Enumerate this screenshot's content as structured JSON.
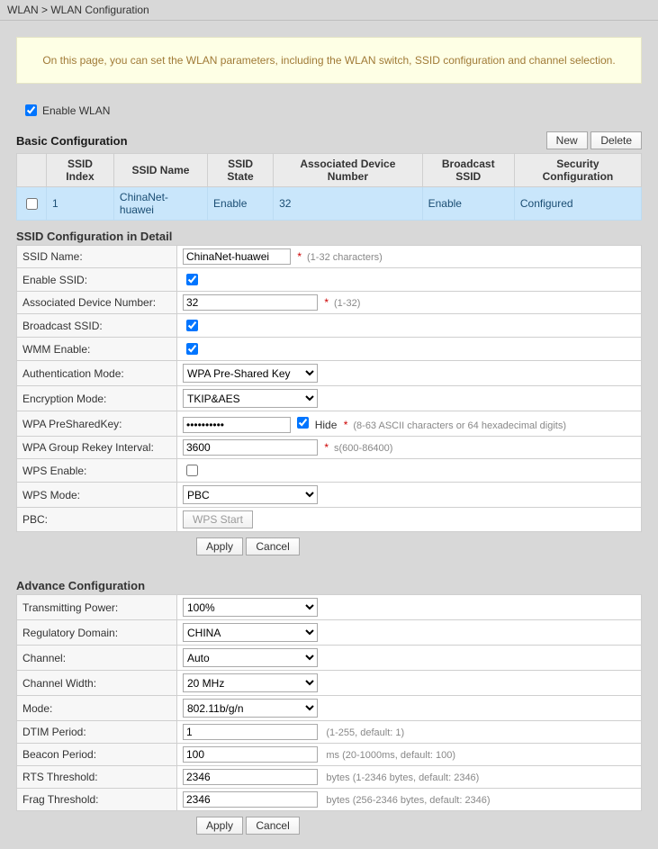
{
  "breadcrumb": "WLAN > WLAN Configuration",
  "hint": "On this page, you can set the WLAN parameters, including the WLAN switch, SSID configuration and channel selection.",
  "enableWlan": {
    "label": "Enable WLAN",
    "checked": true
  },
  "basic": {
    "title": "Basic Configuration",
    "btn_new": "New",
    "btn_delete": "Delete",
    "headers": {
      "idx": "SSID Index",
      "name": "SSID Name",
      "state": "SSID State",
      "assoc": "Associated Device Number",
      "bcast": "Broadcast SSID",
      "sec": "Security Configuration"
    },
    "row": {
      "idx": "1",
      "name": "ChinaNet-huawei",
      "state": "Enable",
      "assoc": "32",
      "bcast": "Enable",
      "sec": "Configured"
    }
  },
  "detail": {
    "title": "SSID Configuration in Detail",
    "ssid_name": {
      "label": "SSID Name:",
      "value": "ChinaNet-huawei",
      "hint": "(1-32 characters)"
    },
    "enable_ssid": {
      "label": "Enable SSID:",
      "checked": true
    },
    "assoc": {
      "label": "Associated Device Number:",
      "value": "32",
      "hint": "(1-32)"
    },
    "bcast": {
      "label": "Broadcast SSID:",
      "checked": true
    },
    "wmm": {
      "label": "WMM Enable:",
      "checked": true
    },
    "auth": {
      "label": "Authentication Mode:",
      "value": "WPA Pre-Shared Key"
    },
    "enc": {
      "label": "Encryption Mode:",
      "value": "TKIP&AES"
    },
    "psk": {
      "label": "WPA PreSharedKey:",
      "value": "••••••••••",
      "hide": "Hide ",
      "hint": "(8-63 ASCII characters or 64 hexadecimal digits)"
    },
    "rekey": {
      "label": "WPA Group Rekey Interval:",
      "value": "3600",
      "hint": "s(600-86400)"
    },
    "wps_enable": {
      "label": "WPS Enable:",
      "checked": false
    },
    "wps_mode": {
      "label": "WPS Mode:",
      "value": "PBC"
    },
    "pbc": {
      "label": "PBC:",
      "button": "WPS Start"
    },
    "apply": "Apply",
    "cancel": "Cancel"
  },
  "adv": {
    "title": "Advance Configuration",
    "tx": {
      "label": "Transmitting Power:",
      "value": "100%"
    },
    "reg": {
      "label": "Regulatory Domain:",
      "value": "CHINA"
    },
    "chan": {
      "label": "Channel:",
      "value": "Auto"
    },
    "width": {
      "label": "Channel Width:",
      "value": "20 MHz"
    },
    "mode": {
      "label": "Mode:",
      "value": "802.11b/g/n"
    },
    "dtim": {
      "label": "DTIM Period:",
      "value": "1",
      "hint": "(1-255, default: 1)"
    },
    "beacon": {
      "label": "Beacon Period:",
      "value": "100",
      "hint": "ms (20-1000ms, default: 100)"
    },
    "rts": {
      "label": "RTS Threshold:",
      "value": "2346",
      "hint": "bytes (1-2346 bytes, default: 2346)"
    },
    "frag": {
      "label": "Frag Threshold:",
      "value": "2346",
      "hint": "bytes (256-2346 bytes, default: 2346)"
    },
    "apply": "Apply",
    "cancel": "Cancel"
  }
}
